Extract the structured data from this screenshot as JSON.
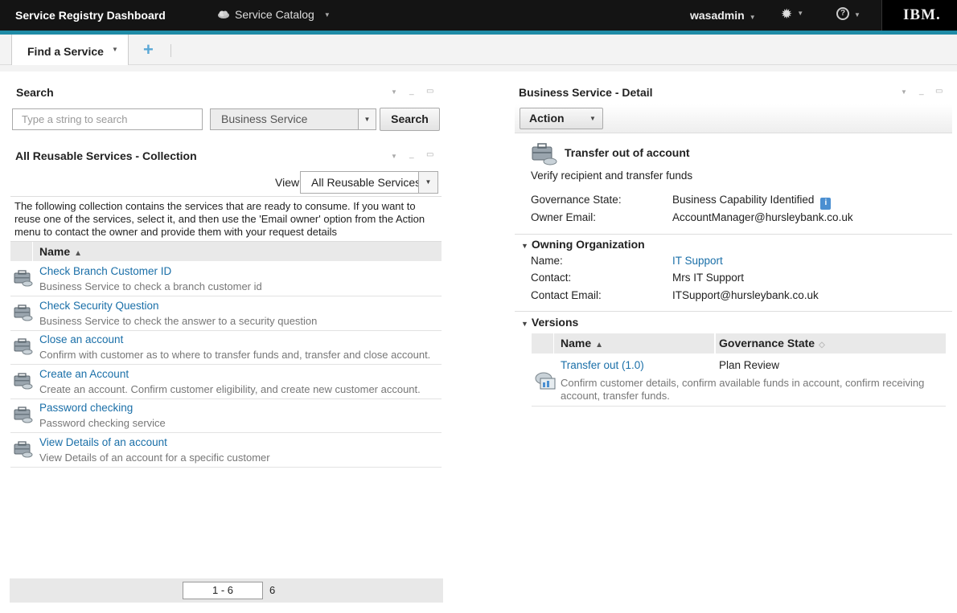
{
  "header": {
    "app_title": "Service Registry Dashboard",
    "catalog_menu": "Service Catalog",
    "user": "wasadmin",
    "logo": "IBM."
  },
  "tabs": {
    "active": "Find a Service"
  },
  "search_widget": {
    "title": "Search",
    "input_placeholder": "Type a string to search",
    "type_select": "Business Service",
    "search_button": "Search"
  },
  "collection": {
    "title": "All Reusable Services - Collection",
    "view_label": "View",
    "view_select": "All Reusable Services",
    "description": "The following collection contains the services that are ready to consume. If you want to reuse one of the services, select it, and then use the 'Email owner' option from the Action menu to contact the owner and provide them with your request details",
    "column_name": "Name",
    "rows": [
      {
        "name": "Check Branch Customer ID",
        "desc": "Business Service to check a branch customer id"
      },
      {
        "name": "Check Security Question",
        "desc": "Business Service to check the answer to a security question"
      },
      {
        "name": "Close an account",
        "desc": "Confirm with customer as to where to transfer funds and, transfer and close account."
      },
      {
        "name": "Create an Account",
        "desc": "Create an account. Confirm customer eligibility, and create new customer account."
      },
      {
        "name": "Password checking",
        "desc": "Password checking service"
      },
      {
        "name": "View Details of an account",
        "desc": "View Details of an account for a specific customer"
      }
    ],
    "pager_range": "1 - 6",
    "pager_total": "6"
  },
  "detail": {
    "title": "Business Service - Detail",
    "action_button": "Action",
    "service_name": "Transfer out of account",
    "service_desc": "Verify recipient and transfer funds",
    "governance_label": "Governance State:",
    "governance_value": "Business Capability Identified",
    "owner_email_label": "Owner Email:",
    "owner_email_value": "AccountManager@hursleybank.co.uk",
    "owning_org": {
      "title": "Owning Organization",
      "name_label": "Name:",
      "name_value": "IT Support",
      "contact_label": "Contact:",
      "contact_value": "Mrs IT Support",
      "contact_email_label": "Contact Email:",
      "contact_email_value": "ITSupport@hursleybank.co.uk"
    },
    "versions": {
      "title": "Versions",
      "col_name": "Name",
      "col_state": "Governance State",
      "row_name": "Transfer out (1.0)",
      "row_state": "Plan Review",
      "row_desc": "Confirm customer details, confirm available funds in account, confirm receiving account, transfer funds."
    }
  }
}
